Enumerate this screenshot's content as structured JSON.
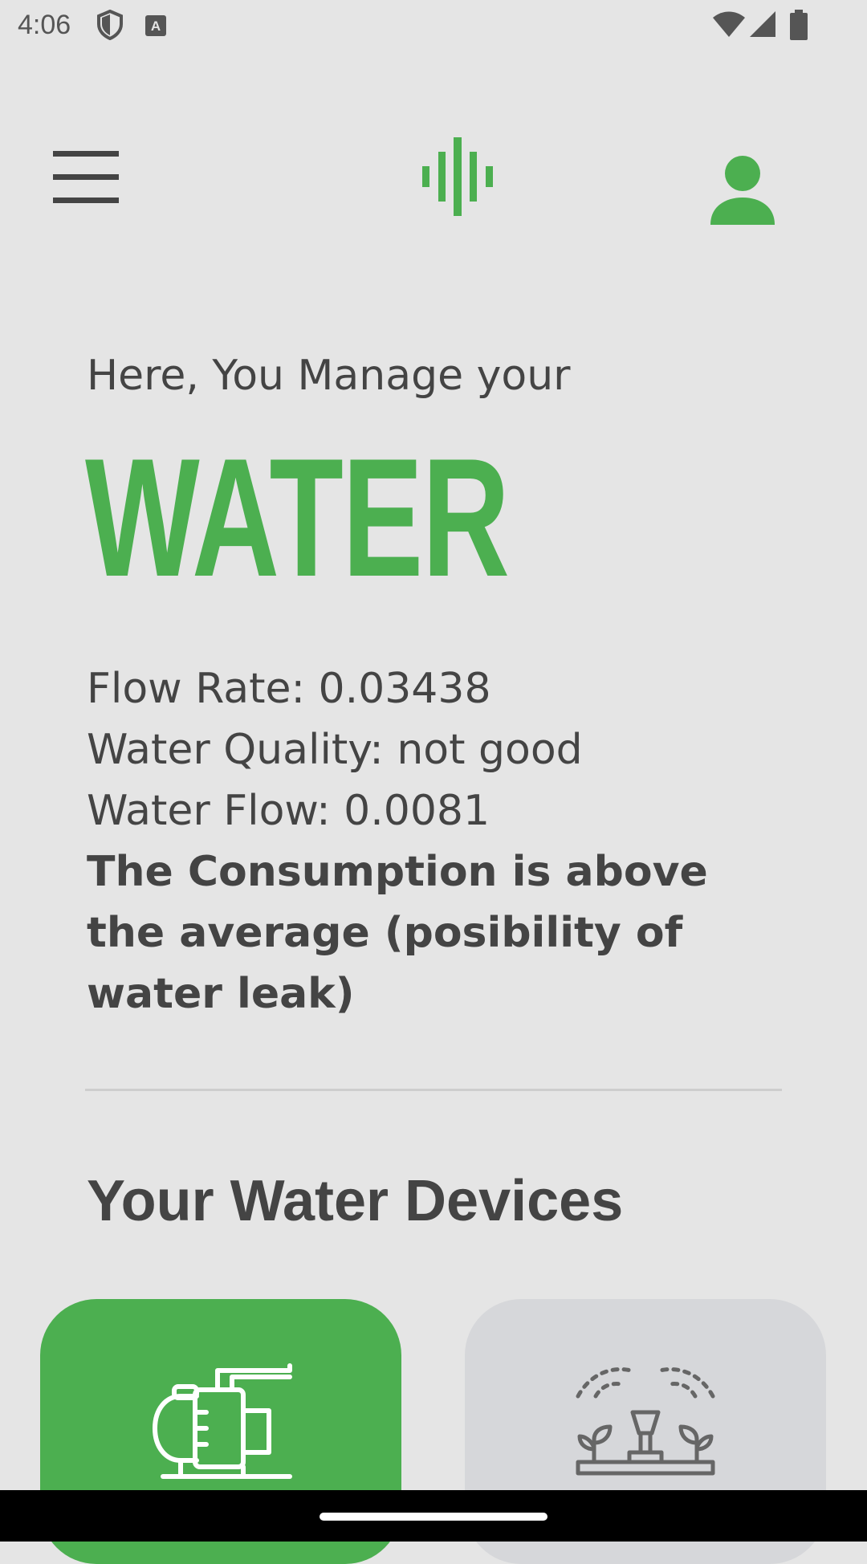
{
  "status_bar": {
    "time": "4:06",
    "icons": [
      "shield-icon",
      "text-input-icon",
      "wifi-icon",
      "signal-icon",
      "battery-icon"
    ]
  },
  "app_bar": {
    "menu_icon": "hamburger-menu-icon",
    "logo_icon": "sound-wave-logo-icon",
    "profile_icon": "person-icon"
  },
  "main": {
    "intro": "Here, You Manage your",
    "headline": "WATER",
    "stats": {
      "flow_rate": "Flow Rate: 0.03438",
      "water_quality": "Water Quality: not good",
      "water_flow": "Water Flow: 0.0081",
      "warning": "The Consumption is above the average (posibility of water leak)"
    },
    "devices_title": "Your Water Devices",
    "devices": [
      {
        "icon": "water-pump-icon",
        "selected": true
      },
      {
        "icon": "sprinkler-icon",
        "selected": false
      }
    ]
  },
  "colors": {
    "accent": "#4caf50",
    "background": "#e5e5e5",
    "text": "#444444",
    "card_inactive": "#d6d7da"
  }
}
